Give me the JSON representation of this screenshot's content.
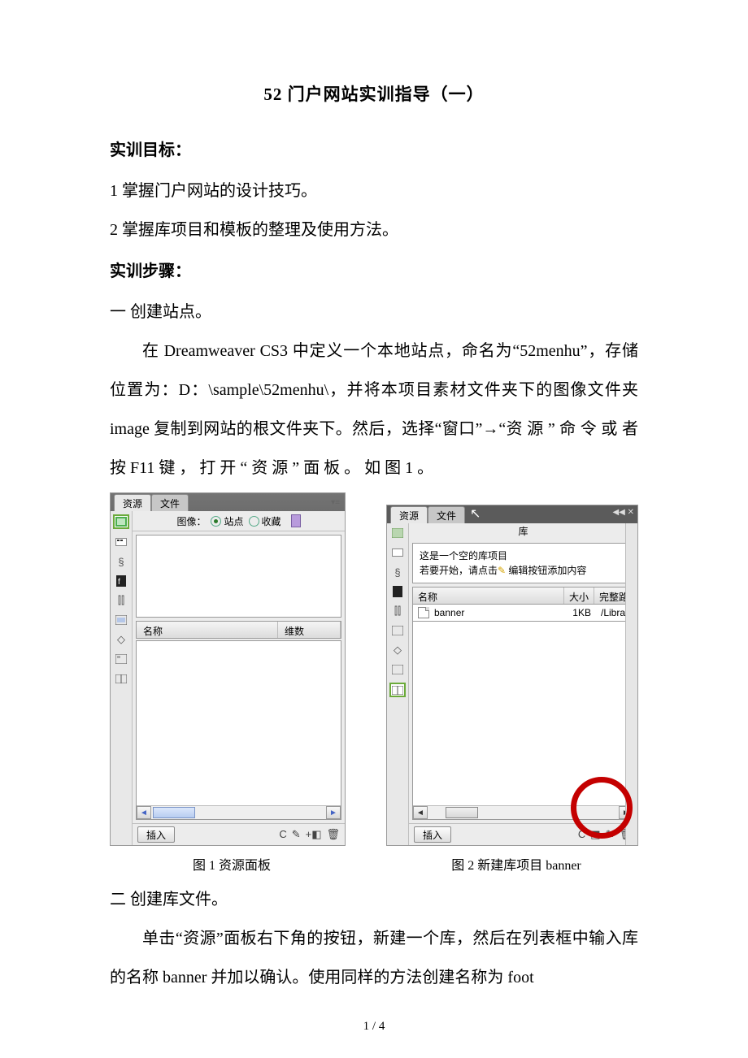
{
  "title": "52 门户网站实训指导（一）",
  "section_goal_heading": "实训目标：",
  "goal_1": "1 掌握门户网站的设计技巧。",
  "goal_2": "2  掌握库项目和模板的整理及使用方法。",
  "section_step_heading": "实训步骤：",
  "step1_heading": " 一 创建站点。",
  "step1_body": "在 Dreamweaver CS3 中定义一个本地站点，命名为“52menhu”，存储位置为：D：\\sample\\52menhu\\，并将本项目素材文件夹下的图像文件夹 image 复制到网站的根文件夹下。然后，选择“窗口”→“资 源 ” 命 令 或 者 按 F11 键 ， 打 开 “ 资 源 ” 面 板 。 如 图 1 。",
  "panel1": {
    "tab1": "资源",
    "tab2": "文件",
    "filter_label": "图像：",
    "radio_site": "站点",
    "radio_fav": "收藏",
    "col_name": "名称",
    "col_dim": "维数",
    "insert_btn": "插入"
  },
  "panel2": {
    "tab1": "资源",
    "tab2": "文件",
    "lib_title": "库",
    "msg_line1": "这是一个空的库项目",
    "msg_line2_a": "若要开始，请点击",
    "msg_line2_b": "编辑按钮添加内容",
    "col_name": "名称",
    "col_size": "大小",
    "col_path": "完整路",
    "row_name": "banner",
    "row_size": "1KB",
    "row_path": "/Librar",
    "insert_btn": "插入"
  },
  "caption1": "图 1 资源面板",
  "caption2": "图 2  新建库项目 banner",
  "step2_heading": "二 创建库文件。",
  "step2_body": "单击“资源”面板右下角的按钮，新建一个库，然后在列表框中输入库的名称 banner 并加以确认。使用同样的方法创建名称为 foot",
  "page_number": "1 / 4"
}
